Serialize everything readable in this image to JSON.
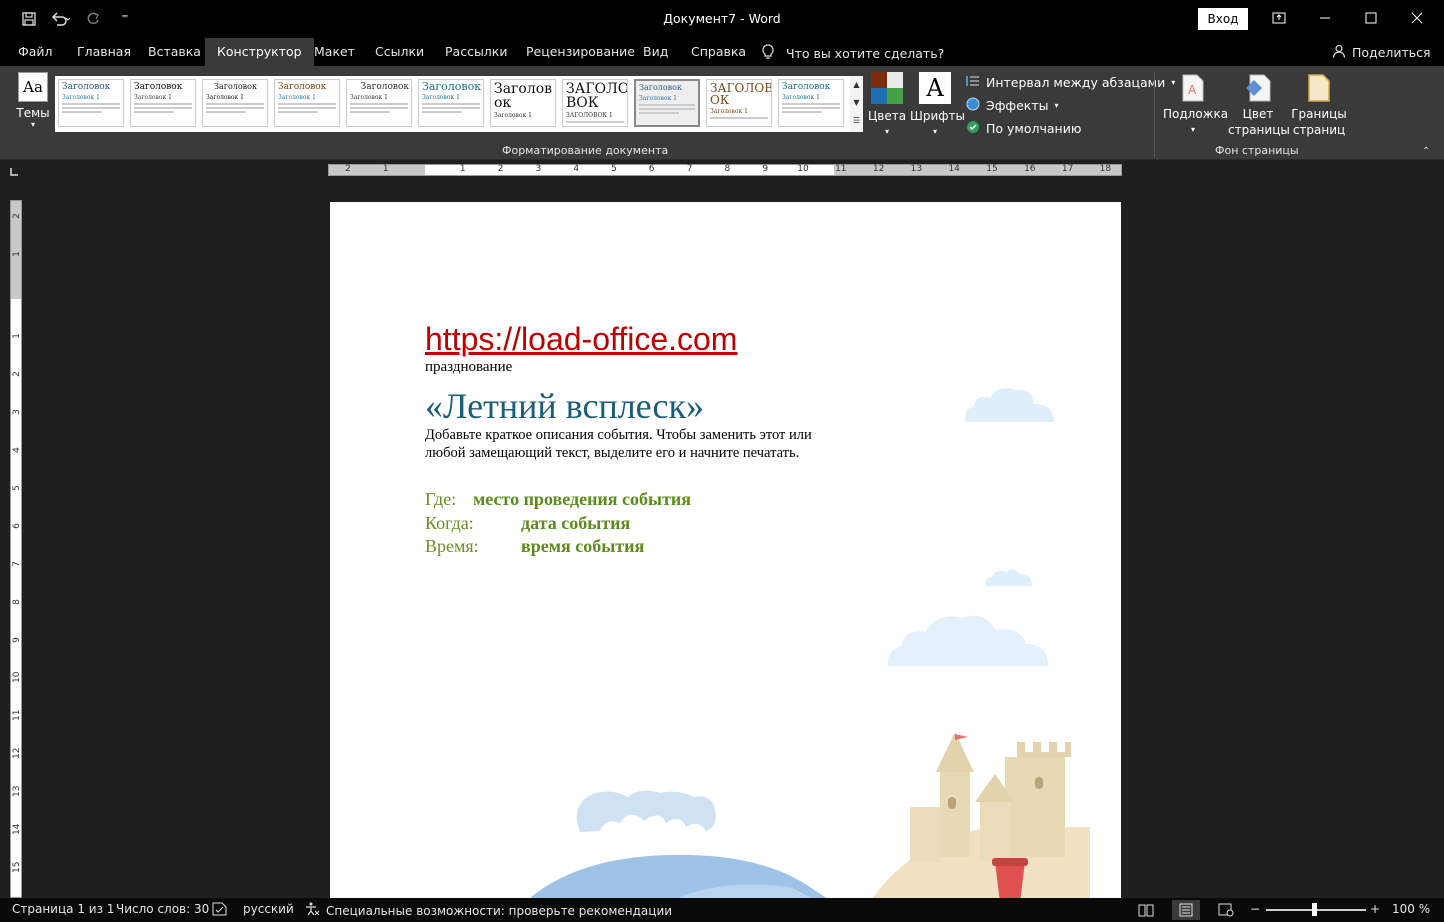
{
  "titlebar": {
    "doc_title": "Документ7  -  Word",
    "signin_label": "Вход",
    "qat_customize": "⁼"
  },
  "tabs": [
    {
      "label": "Файл"
    },
    {
      "label": "Главная"
    },
    {
      "label": "Вставка"
    },
    {
      "label": "Конструктор"
    },
    {
      "label": "Макет"
    },
    {
      "label": "Ссылки"
    },
    {
      "label": "Рассылки"
    },
    {
      "label": "Рецензирование"
    },
    {
      "label": "Вид"
    },
    {
      "label": "Справка"
    }
  ],
  "tellme": {
    "label": "Что вы хотите сделать?"
  },
  "share": {
    "label": "Поделиться"
  },
  "ribbon": {
    "themes_label": "Темы",
    "themes_glyph": "Aa",
    "gallery_items": [
      {
        "heading": "Заголовок",
        "sub": "Заголовок 1"
      },
      {
        "heading": "Заголовок",
        "sub": "Заголовок 1"
      },
      {
        "heading": "Заголовок",
        "sub": "Заголовок 1"
      },
      {
        "heading": "Заголовок",
        "sub": "Заголовок 1"
      },
      {
        "heading": "Заголовок",
        "sub": "Заголовок 1"
      },
      {
        "heading": "Заголовок",
        "sub": "Заголовок 1"
      },
      {
        "heading": "Заголов ок",
        "sub": "Заголовок 1"
      },
      {
        "heading": "ЗАГОЛО ВОК",
        "sub": "ЗАГОЛОВОК 1"
      },
      {
        "heading": "Заголовок",
        "sub": "Заголовок 1"
      },
      {
        "heading": "ЗАГОЛОВ ОК",
        "sub": "Заголовок 1"
      },
      {
        "heading": "Заголовок",
        "sub": "Заголовок 1"
      }
    ],
    "colors_label": "Цвета",
    "fonts_label": "Шрифты",
    "fonts_glyph": "A",
    "paragraph_spacing_label": "Интервал между абзацами",
    "effects_label": "Эффекты",
    "default_label": "По умолчанию",
    "group_format_label": "Форматирование документа",
    "watermark_label": "Подложка",
    "page_color_label": "Цвет страницы",
    "page_borders_label": "Границы страниц",
    "group_background_label": "Фон страницы"
  },
  "ruler": {
    "h_numbers": [
      "2",
      "1",
      "1",
      "2",
      "3",
      "4",
      "5",
      "6",
      "7",
      "8",
      "9",
      "10",
      "11",
      "12",
      "13",
      "14",
      "15",
      "16",
      "17",
      "18"
    ],
    "v_numbers": [
      "2",
      "1",
      "1",
      "2",
      "3",
      "4",
      "5",
      "6",
      "7",
      "8",
      "9",
      "10",
      "11",
      "12",
      "13",
      "14",
      "15"
    ]
  },
  "document": {
    "link": "https://load-office.com",
    "event_label": "празднование",
    "event_title": "«Летний всплеск»",
    "description": "Добавьте краткое описания события. Чтобы заменить этот или любой замещающий текст, выделите его и начните печатать.",
    "details": [
      {
        "label": "Где:",
        "value": "место проведения события"
      },
      {
        "label": "Когда:",
        "value": "дата события"
      },
      {
        "label": "Время:",
        "value": "время события"
      }
    ]
  },
  "status": {
    "page": "Страница 1 из 1",
    "words": "Число слов: 30",
    "language": "русский",
    "accessibility": "Специальные возможности: проверьте рекомендации",
    "zoom": "100 %",
    "zoom_minus": "−",
    "zoom_plus": "+"
  },
  "colors": {
    "link": "#c00000",
    "title": "#1a5e7a",
    "details": "#5e8c1c"
  }
}
